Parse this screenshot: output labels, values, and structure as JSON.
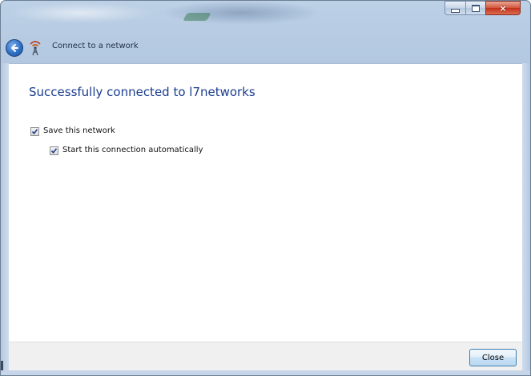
{
  "window": {
    "caption_buttons": {
      "minimize": "minimize-icon",
      "maximize": "maximize-icon",
      "close": "×"
    }
  },
  "nav": {
    "back_icon": "back-arrow-icon",
    "network_icon": "wireless-network-icon",
    "title": "Connect to a network"
  },
  "main": {
    "heading": "Successfully connected to l7networks",
    "options": [
      {
        "label": "Save this network",
        "checked": true
      },
      {
        "label": "Start this connection automatically",
        "checked": true
      }
    ]
  },
  "footer": {
    "close_label": "Close"
  },
  "colors": {
    "heading": "#1a3d8f",
    "glass": "#b4c8de",
    "close_accent": "#c2321b"
  }
}
